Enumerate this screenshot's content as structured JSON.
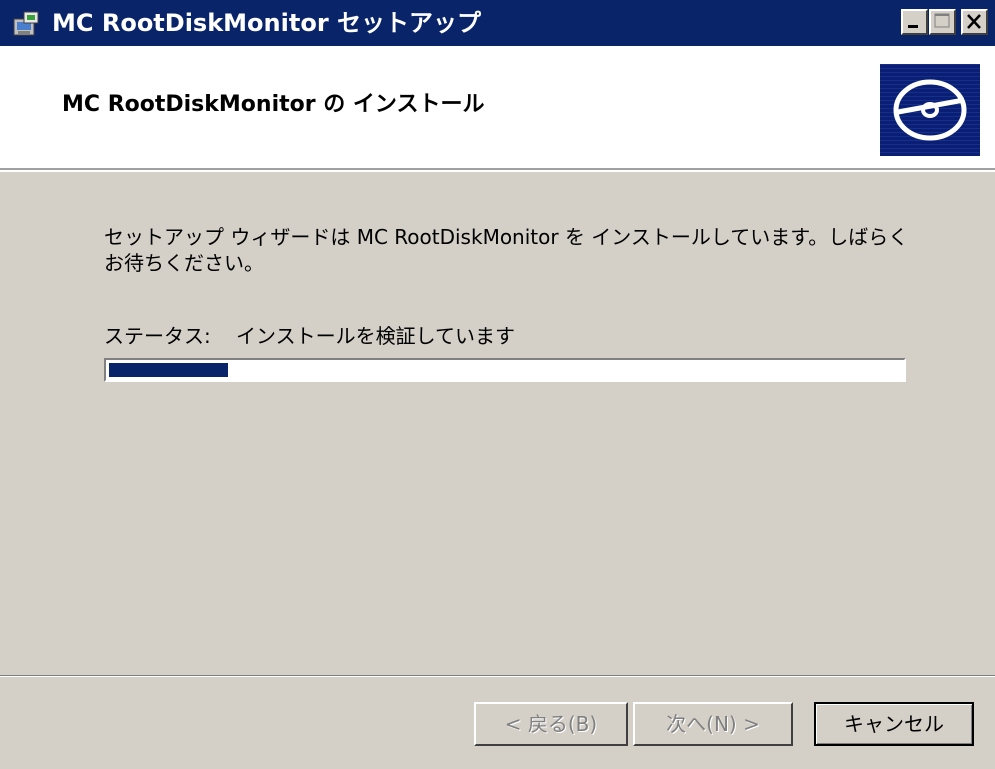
{
  "window": {
    "title": "MC RootDiskMonitor セットアップ",
    "controls": {
      "minimize": "minimize-icon",
      "maximize": "maximize-icon",
      "close": "close-icon"
    }
  },
  "header": {
    "title": "MC RootDiskMonitor の インストール",
    "logo_icon": "disk-icon"
  },
  "body": {
    "description": "セットアップ ウィザードは MC RootDiskMonitor を インストールしています。しばらくお待ちください。",
    "status_label": "ステータス:",
    "status_value": "インストールを検証しています",
    "progress": 0.15
  },
  "footer": {
    "back_label": "< 戻る(B)",
    "next_label": "次へ(N) >",
    "cancel_label": "キャンセル"
  },
  "colors": {
    "titlebar": "#0a246a",
    "progress_fill": "#0a246a",
    "dialog_bg": "#d4d0c8"
  }
}
